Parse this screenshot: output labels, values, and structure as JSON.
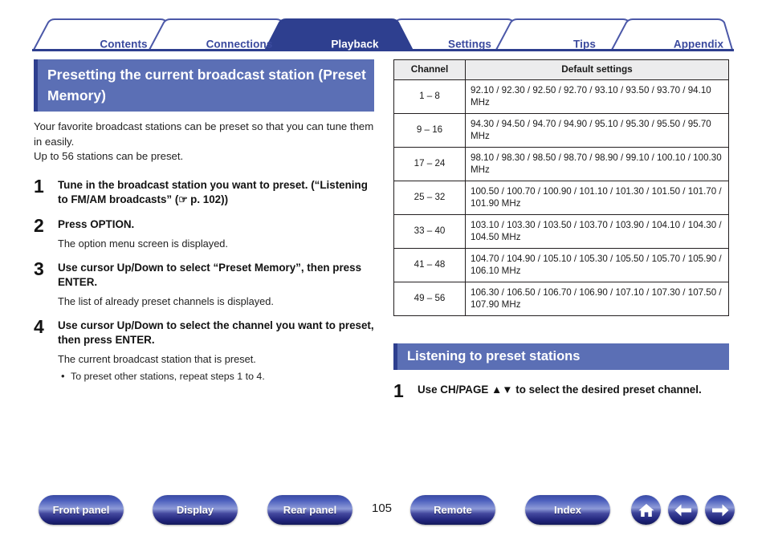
{
  "tabs": [
    {
      "label": "Contents",
      "active": false
    },
    {
      "label": "Connections",
      "active": false
    },
    {
      "label": "Playback",
      "active": true
    },
    {
      "label": "Settings",
      "active": false
    },
    {
      "label": "Tips",
      "active": false
    },
    {
      "label": "Appendix",
      "active": false
    }
  ],
  "left": {
    "heading": "Presetting the current broadcast station (Preset Memory)",
    "intro_line1": "Your favorite broadcast stations can be preset so that you can tune them in easily.",
    "intro_line2": "Up to 56 stations can be preset.",
    "steps": [
      {
        "num": "1",
        "title_part1": "Tune in the broadcast station you want to preset. (“Listening to FM/AM broadcasts” (",
        "icon": "pointing-hand-icon",
        "icon_glyph": "☞",
        "title_part2": " p. 102))",
        "desc": "",
        "bullets": []
      },
      {
        "num": "2",
        "title_part1": "Press OPTION.",
        "icon": "",
        "icon_glyph": "",
        "title_part2": "",
        "desc": "The option menu screen is displayed.",
        "bullets": []
      },
      {
        "num": "3",
        "title_part1": "Use cursor Up/Down to select “Preset Memory”, then press ENTER.",
        "icon": "",
        "icon_glyph": "",
        "title_part2": "",
        "desc": "The list of already preset channels is displayed.",
        "bullets": []
      },
      {
        "num": "4",
        "title_part1": "Use cursor Up/Down to select the channel you want to preset, then press ENTER.",
        "icon": "",
        "icon_glyph": "",
        "title_part2": "",
        "desc": "The current broadcast station that is preset.",
        "bullets": [
          "To preset other stations, repeat steps 1 to 4."
        ]
      }
    ]
  },
  "right": {
    "table": {
      "headers": [
        "Channel",
        "Default settings"
      ],
      "rows": [
        {
          "channel": "1 – 8",
          "settings": "92.10 / 92.30 / 92.50 / 92.70 / 93.10 / 93.50 / 93.70 / 94.10 MHz"
        },
        {
          "channel": "9 – 16",
          "settings": "94.30 / 94.50 / 94.70 / 94.90 / 95.10 / 95.30 / 95.50 / 95.70 MHz"
        },
        {
          "channel": "17 – 24",
          "settings": "98.10 / 98.30 / 98.50 / 98.70 / 98.90 / 99.10 / 100.10 / 100.30 MHz"
        },
        {
          "channel": "25 – 32",
          "settings": "100.50 / 100.70 / 100.90 / 101.10 / 101.30 / 101.50 / 101.70 / 101.90 MHz"
        },
        {
          "channel": "33 – 40",
          "settings": "103.10 / 103.30 / 103.50 / 103.70 / 103.90 / 104.10 / 104.30 / 104.50 MHz"
        },
        {
          "channel": "41 – 48",
          "settings": "104.70 / 104.90 / 105.10 / 105.30 / 105.50 / 105.70 / 105.90 / 106.10 MHz"
        },
        {
          "channel": "49 – 56",
          "settings": "106.30 / 106.50 / 106.70 / 106.90 / 107.10 / 107.30 / 107.50 / 107.90 MHz"
        }
      ]
    },
    "heading": "Listening to preset stations",
    "steps": [
      {
        "num": "1",
        "title": "Use CH/PAGE ▲▼ to select the desired preset channel."
      }
    ]
  },
  "footer": {
    "buttons": [
      {
        "label": "Front panel"
      },
      {
        "label": "Display"
      },
      {
        "label": "Rear panel"
      },
      {
        "label": "Remote"
      },
      {
        "label": "Index"
      }
    ],
    "icons": [
      "home-icon",
      "back-arrow-icon",
      "forward-arrow-icon"
    ],
    "page_number": "105"
  },
  "colors": {
    "accent_dark": "#2e3f8f",
    "accent_mid": "#5b6fb5",
    "tab_text": "#3b4a9e",
    "table_header_bg": "#ececed"
  }
}
